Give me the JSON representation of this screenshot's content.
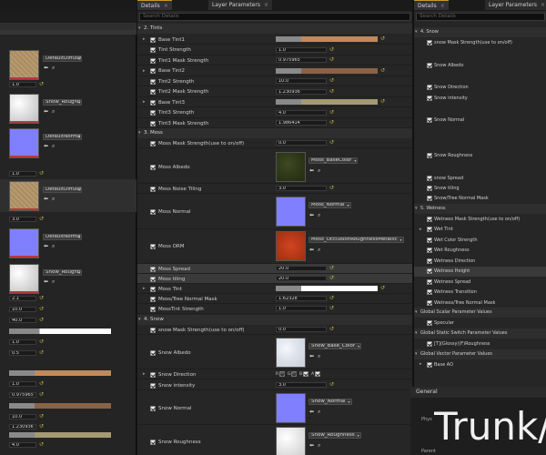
{
  "tabs": {
    "details": "Details",
    "layer_params": "Layer Parameters"
  },
  "search_placeholder": "Search Details",
  "left": {
    "textures": [
      {
        "name": "DefaultDiffuse",
        "kind": "diffuse"
      },
      {
        "name": "Snow_Roughness",
        "kind": "rough"
      },
      {
        "name": "DefaultNormal",
        "kind": "normal"
      },
      {
        "name": "DefaultDiffuse",
        "kind": "diffuse"
      },
      {
        "name": "DefaultNormal",
        "kind": "normal"
      },
      {
        "name": "Snow_Roughness",
        "kind": "rough"
      }
    ],
    "values": [
      "1.0",
      "1.0",
      "3.0",
      "2.1",
      "10.0",
      "40.0",
      "1.0",
      "0.5",
      "1.0",
      "0.975965",
      "10.0",
      "1.230936",
      "4.0"
    ]
  },
  "center": {
    "sections": {
      "tints": "2. Tints",
      "moss": "3. Moss",
      "snow": "4. Snow"
    },
    "tints": [
      {
        "label": "Base Tint1",
        "value": ""
      },
      {
        "label": "Tint Strength",
        "value": "1.0"
      },
      {
        "label": "Tint1 Mask Strength",
        "value": "0.975965"
      },
      {
        "label": "Base Tint2",
        "value": ""
      },
      {
        "label": "Tint2 Strength",
        "value": "10.0"
      },
      {
        "label": "Tint2 Mask Strength",
        "value": "1.230936"
      },
      {
        "label": "Base Tint3",
        "value": ""
      },
      {
        "label": "Tint3 Strength",
        "value": "4.0"
      },
      {
        "label": "Tint3 Mask Strength",
        "value": "1.986414"
      }
    ],
    "moss": {
      "mask_strength_label": "Moss Mask Strength(use to on/off)",
      "mask_strength": "0.0",
      "albedo_label": "Moss Albedo",
      "albedo_tex": "Moss_BaseColor",
      "noise_label": "Moss Noise Tiling",
      "noise": "3.0",
      "normal_label": "Moss Normal",
      "normal_tex": "Moss_Normal",
      "orm_label": "Moss ORM",
      "orm_tex": "Moss_OcclusionRoughnessMetallic",
      "spread_label": "Moss Spread",
      "spread": "20.0",
      "tiling_label": "Moss tiling",
      "tiling": "20.0",
      "tint_label": "Moss Tint",
      "tree_label": "Moss/Tree Normal Mask",
      "tree": "1.62328",
      "tint_strength_label": "MossTint Strength",
      "tint_strength": "1.0"
    },
    "snow": {
      "mask_strength_label": "snow Mask Strength(use to on/off)",
      "mask_strength": "0.0",
      "albedo_label": "Snow Albedo",
      "albedo_tex": "Snow_Base_Color",
      "direction_label": "Snow Direction",
      "rgba": [
        "R",
        "G",
        "B",
        "A"
      ],
      "intensity_label": "Snow intensity",
      "intensity": "3.0",
      "normal_label": "Snow Normal",
      "normal_tex": "Snow_Normal",
      "roughness_label": "Snow Roughness",
      "roughness_tex": "Snow_Roughness"
    }
  },
  "right": {
    "snow_header": "4. Snow",
    "snow_items": [
      "snow Mask Strength(use to on/off)",
      "Snow Albedo",
      "Snow Direction",
      "Snow intensity",
      "Snow Normal",
      "Snow Roughness",
      "snow Spread",
      "Snow tiling",
      "Snow/Tree Normal Mask"
    ],
    "wetness_header": "5. Wetness",
    "wetness_items": [
      "Wetness Mask Strength(use to on/off)",
      "Wet Tint",
      "Wet Color Strength",
      "Wet Roughness",
      "Wetness Direction",
      "Wetness Height",
      "Wetness Spread",
      "Wetness Transition",
      "Wetness/Tree Normal Mask"
    ],
    "scalar_header": "Global Scalar Parameter Values",
    "scalar_item": "Specular",
    "static_header": "Global Static Switch Parameter Values",
    "static_item": "[T](Glossy)(F)Roughness",
    "vector_header": "Global Vector Parameter Values",
    "vector_item": "Base AO"
  },
  "general": {
    "header": "General",
    "phys": "Phys",
    "parent": "Parent",
    "overlay": "Trunk/br"
  }
}
